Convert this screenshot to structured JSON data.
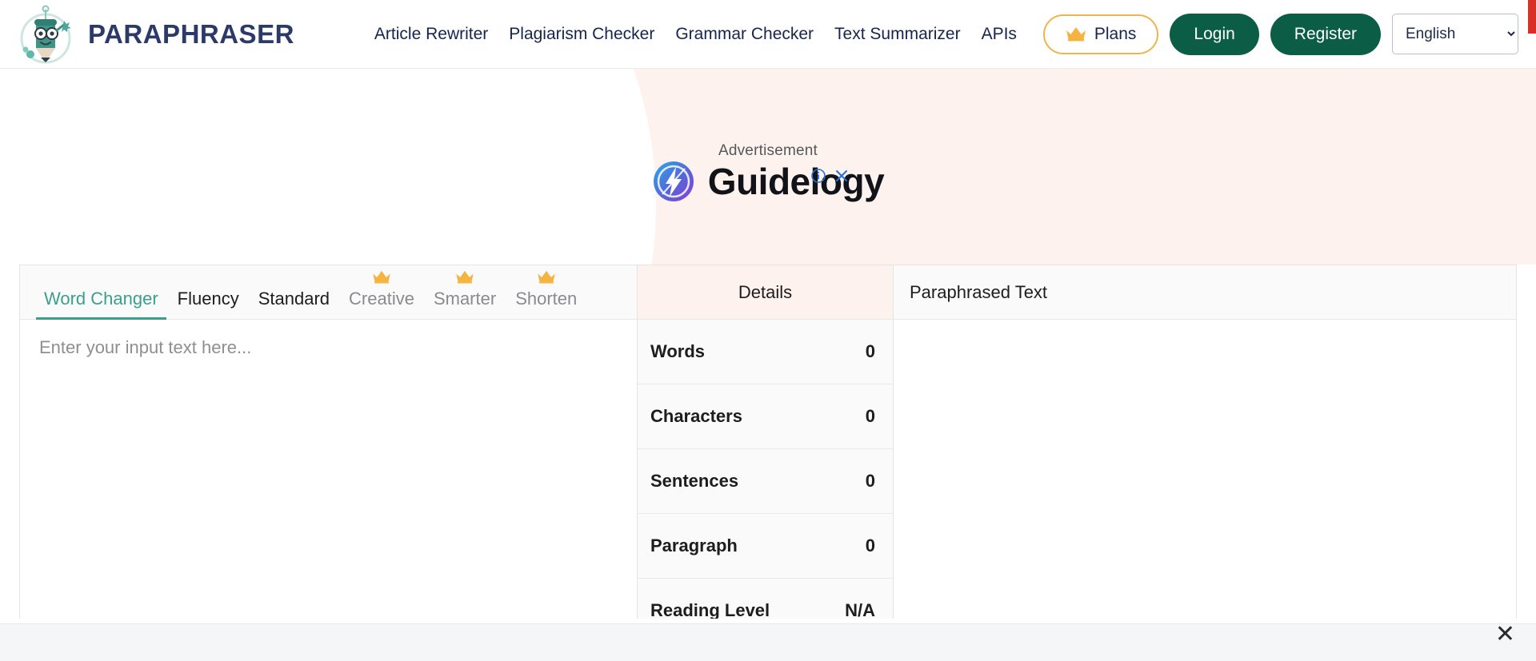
{
  "header": {
    "brand_name": "PARAPHRASER",
    "brand_logo_icon": "robot-pencil-mascot-icon",
    "nav": [
      {
        "label": "Article Rewriter"
      },
      {
        "label": "Plagiarism Checker"
      },
      {
        "label": "Grammar Checker"
      },
      {
        "label": "Text Summarizer"
      },
      {
        "label": "APIs"
      }
    ],
    "plans_button": {
      "label": "Plans",
      "icon": "crown-icon",
      "border_color": "#f0b44a"
    },
    "login_button": {
      "label": "Login",
      "color": "#0b5e45"
    },
    "register_button": {
      "label": "Register",
      "color": "#0b5e45"
    },
    "language_select": {
      "value": "English",
      "icon": "chevron-down-icon"
    }
  },
  "advertisement": {
    "label": "Advertisement",
    "info_icon": "ad-info-icon",
    "close_icon": "ad-close-icon",
    "brand_text": "Guidelogy",
    "brand_icon": "lightning-bolt-circle-icon",
    "background_color": "#fdf2ee"
  },
  "editor": {
    "tabs": [
      {
        "label": "Word Changer",
        "active": true,
        "locked": false
      },
      {
        "label": "Fluency",
        "active": false,
        "locked": false
      },
      {
        "label": "Standard",
        "active": false,
        "locked": false
      },
      {
        "label": "Creative",
        "active": false,
        "locked": true
      },
      {
        "label": "Smarter",
        "active": false,
        "locked": true
      },
      {
        "label": "Shorten",
        "active": false,
        "locked": true
      }
    ],
    "input_placeholder": "Enter your input text here...",
    "input_value": "",
    "active_tab_color": "#3aa08c"
  },
  "details": {
    "title": "Details",
    "rows": [
      {
        "label": "Words",
        "value": "0"
      },
      {
        "label": "Characters",
        "value": "0"
      },
      {
        "label": "Sentences",
        "value": "0"
      },
      {
        "label": "Paragraph",
        "value": "0"
      },
      {
        "label": "Reading Level",
        "value": "N/A"
      }
    ]
  },
  "output": {
    "title": "Paraphrased Text",
    "content": ""
  },
  "bottom_bar": {
    "close_icon": "close-icon",
    "close_label": "✕"
  }
}
